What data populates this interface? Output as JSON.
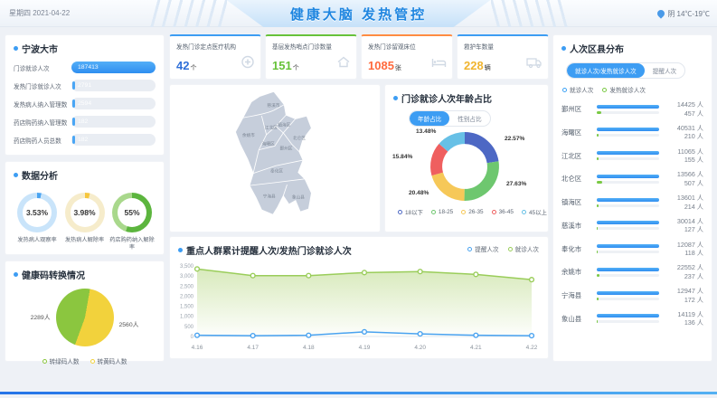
{
  "header": {
    "date": "星期四 2021-04-22",
    "title": "健康大脑 发热管控",
    "weather": "阴 14℃-19℃"
  },
  "ningbo": {
    "title": "宁波大市",
    "rows": [
      {
        "label": "门诊就诊人次",
        "value": "187413",
        "filled": true
      },
      {
        "label": "发热门诊就诊人次",
        "value": "2791",
        "filled": false
      },
      {
        "label": "发热病人纳入管理数",
        "value": "2594",
        "filled": false
      },
      {
        "label": "药店购药纳入管理数",
        "value": "182",
        "filled": false
      },
      {
        "label": "药店购药人员总数",
        "value": "182",
        "filled": false
      }
    ]
  },
  "analysis": {
    "title": "数据分析",
    "gauges": [
      {
        "value": "3.53%",
        "pct": 3.53,
        "label": "发热病人观察率",
        "color": "#4aa4f1",
        "track": "#c9e4fa"
      },
      {
        "value": "3.98%",
        "pct": 3.98,
        "label": "发热病人解除率",
        "color": "#f6c63c",
        "track": "#f6eccb"
      },
      {
        "value": "55%",
        "pct": 55,
        "label": "药店购药纳入解除率",
        "color": "#5cb53e",
        "track": "#a9d88c"
      }
    ]
  },
  "healthcode": {
    "title": "健康码转换情况",
    "slices": [
      {
        "label": "2289人",
        "name": "转绿码人数",
        "value": 2289,
        "color": "#8bc63f"
      },
      {
        "label": "2560人",
        "name": "转黄码人数",
        "value": 2560,
        "color": "#f2d23c"
      }
    ]
  },
  "kpis": [
    {
      "title": "发热门诊定点医疗机构",
      "value": "42",
      "unit": "个",
      "color": "#2f6fd8",
      "accent": "#3d9df3",
      "icon": "medical-cross-icon"
    },
    {
      "title": "基层发热哨点门诊数量",
      "value": "151",
      "unit": "个",
      "color": "#67c23a",
      "accent": "#67c23a",
      "icon": "house-icon"
    },
    {
      "title": "发热门诊留观床位",
      "value": "1085",
      "unit": "张",
      "color": "#ff6a3d",
      "accent": "#ff8c42",
      "icon": "bed-icon"
    },
    {
      "title": "救护车数量",
      "value": "228",
      "unit": "辆",
      "color": "#f0b42f",
      "accent": "#3d9df3",
      "icon": "ambulance-icon"
    }
  ],
  "age_panel": {
    "title": "门诊就诊人次年龄占比",
    "toggle": [
      "年龄占比",
      "性别占比"
    ],
    "segments": [
      {
        "name": "18以下",
        "pct": "22.57%",
        "value": 22.57,
        "color": "#4d68c4"
      },
      {
        "name": "18-25",
        "pct": "27.63%",
        "value": 27.63,
        "color": "#6ec76f"
      },
      {
        "name": "26-35",
        "pct": "20.48%",
        "value": 20.48,
        "color": "#f6c858"
      },
      {
        "name": "36-45",
        "pct": "15.84%",
        "value": 15.84,
        "color": "#ef5f5f"
      },
      {
        "name": "45以上",
        "pct": "13.48%",
        "value": 13.48,
        "color": "#67c0e6"
      }
    ]
  },
  "trend_panel": {
    "title": "重点人群累计提醒人次/发热门诊就诊人次",
    "x": [
      "4.16",
      "4.17",
      "4.18",
      "4.19",
      "4.20",
      "4.21",
      "4.22"
    ],
    "series": [
      {
        "name": "提醒人次",
        "color": "#4aa3f0",
        "values": [
          60,
          40,
          60,
          230,
          130,
          60,
          40
        ]
      },
      {
        "name": "就诊人次",
        "color": "#9acd5a",
        "values": [
          3350,
          3020,
          3020,
          3170,
          3220,
          3080,
          2820
        ]
      }
    ],
    "ymax": 3500,
    "ystep": 500
  },
  "district_panel": {
    "title": "人次区县分布",
    "toggle": [
      "就诊人次/发热就诊人次",
      "提醒人次"
    ],
    "legend": [
      {
        "name": "就诊人次",
        "color": "#3da2f5"
      },
      {
        "name": "发热就诊人次",
        "color": "#7ac943"
      }
    ],
    "rows": [
      {
        "name": "鄞州区",
        "visits": "14425 人",
        "fever": "457 人",
        "fever_val": 457
      },
      {
        "name": "海曙区",
        "visits": "40531 人",
        "fever": "210 人",
        "fever_val": 210
      },
      {
        "name": "江北区",
        "visits": "11065 人",
        "fever": "155 人",
        "fever_val": 155
      },
      {
        "name": "北仑区",
        "visits": "13566 人",
        "fever": "507 人",
        "fever_val": 507
      },
      {
        "name": "镇海区",
        "visits": "13601 人",
        "fever": "214 人",
        "fever_val": 214
      },
      {
        "name": "慈溪市",
        "visits": "30014 人",
        "fever": "127 人",
        "fever_val": 127
      },
      {
        "name": "奉化市",
        "visits": "12087 人",
        "fever": "118 人",
        "fever_val": 118
      },
      {
        "name": "余姚市",
        "visits": "22552 人",
        "fever": "237 人",
        "fever_val": 237
      },
      {
        "name": "宁海县",
        "visits": "12947 人",
        "fever": "172 人",
        "fever_val": 172
      },
      {
        "name": "象山县",
        "visits": "14119 人",
        "fever": "136 人",
        "fever_val": 136
      }
    ]
  },
  "map": {
    "labels": [
      "慈溪市",
      "余姚市",
      "江北区",
      "镇海区",
      "海曙区",
      "北仑区",
      "鄞州区",
      "奉化区",
      "宁海县",
      "象山县"
    ]
  },
  "chart_data": [
    {
      "type": "pie",
      "title": "门诊就诊人次年龄占比",
      "categories": [
        "18以下",
        "18-25",
        "26-35",
        "36-45",
        "45以上"
      ],
      "values": [
        22.57,
        27.63,
        20.48,
        15.84,
        13.48
      ],
      "legend_position": "bottom",
      "donut": true
    },
    {
      "type": "line",
      "title": "重点人群累计提醒人次/发热门诊就诊人次",
      "x": [
        "4.16",
        "4.17",
        "4.18",
        "4.19",
        "4.20",
        "4.21",
        "4.22"
      ],
      "series": [
        {
          "name": "提醒人次",
          "values": [
            60,
            40,
            60,
            230,
            130,
            60,
            40
          ]
        },
        {
          "name": "就诊人次",
          "values": [
            3350,
            3020,
            3020,
            3170,
            3220,
            3080,
            2820
          ]
        }
      ],
      "ylim": [
        0,
        3500
      ],
      "legend_position": "top-right",
      "area_fill": "就诊人次"
    },
    {
      "type": "pie",
      "title": "健康码转换情况",
      "categories": [
        "转绿码人数",
        "转黄码人数"
      ],
      "values": [
        2289,
        2560
      ]
    },
    {
      "type": "bar",
      "title": "人次区县分布",
      "categories": [
        "鄞州区",
        "海曙区",
        "江北区",
        "北仑区",
        "镇海区",
        "慈溪市",
        "奉化市",
        "余姚市",
        "宁海县",
        "象山县"
      ],
      "series": [
        {
          "name": "就诊人次",
          "values": [
            14425,
            40531,
            11065,
            13566,
            13601,
            30014,
            12087,
            22552,
            12947,
            14119
          ]
        },
        {
          "name": "发热就诊人次",
          "values": [
            457,
            210,
            155,
            507,
            214,
            127,
            118,
            237,
            172,
            136
          ]
        }
      ]
    },
    {
      "type": "pie",
      "title": "数据分析",
      "categories": [
        "发热病人观察率",
        "发热病人解除率",
        "药店购药纳入解除率"
      ],
      "values": [
        3.53,
        3.98,
        55
      ],
      "note": "three ring gauges, percent of 100"
    }
  ]
}
